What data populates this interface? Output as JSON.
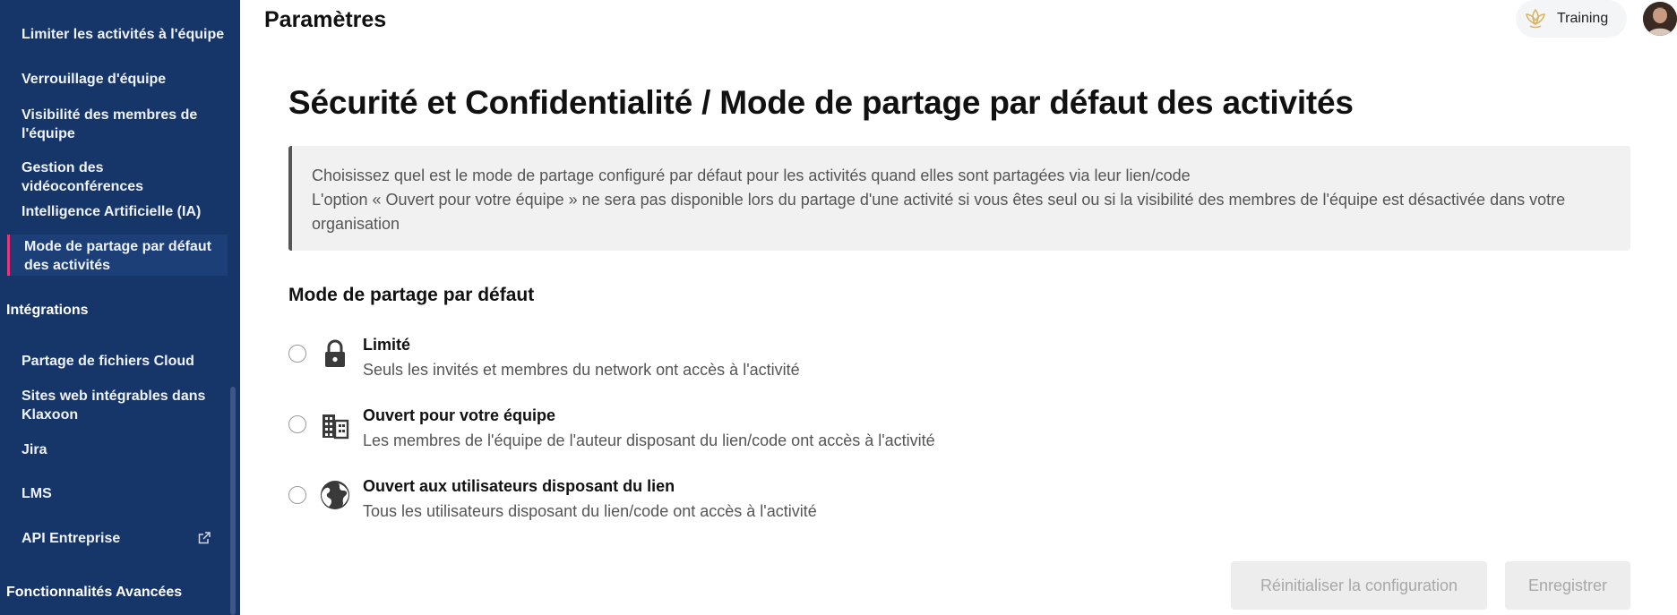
{
  "sidebar": {
    "items": [
      {
        "label": "Limiter les activités à l'équipe"
      },
      {
        "label": "Verrouillage d'équipe"
      },
      {
        "label": "Visibilité des membres de l'équipe"
      },
      {
        "label": "Gestion des vidéoconférences"
      },
      {
        "label": "Intelligence Artificielle (IA)"
      },
      {
        "label": "Mode de partage par défaut des activités",
        "active": true
      }
    ],
    "section_integrations": "Intégrations",
    "integration_items": [
      {
        "label": "Partage de fichiers Cloud"
      },
      {
        "label": "Sites web intégrables dans Klaxoon"
      },
      {
        "label": "Jira"
      },
      {
        "label": "LMS"
      },
      {
        "label": "API Entreprise",
        "icon": "external-link-icon"
      }
    ],
    "section_advanced": "Fonctionnalités Avancées",
    "colors": {
      "background": "#163569",
      "active_marker": "#e8357a"
    }
  },
  "header": {
    "title": "Paramètres",
    "workspace_label": "Training",
    "workspace_icon": "lotus-logo-icon"
  },
  "main": {
    "title": "Sécurité et Confidentialité / Mode de partage par défaut des activités",
    "info_line1": "Choisissez quel est le mode de partage configuré par défaut pour les activités quand elles sont partagées via leur lien/code",
    "info_line2": "L'option « Ouvert pour votre équipe » ne sera pas disponible lors du partage d'une activité si vous êtes seul ou si la visibilité des membres de l'équipe est désactivée dans votre organisation",
    "section_title": "Mode de partage par défaut",
    "options": [
      {
        "title": "Limité",
        "description": "Seuls les invités et membres du network ont accès à l'activité",
        "icon": "lock-icon"
      },
      {
        "title": "Ouvert pour votre équipe",
        "description": "Les membres de l'équipe de l'auteur disposant du lien/code ont accès à l'activité",
        "icon": "building-icon"
      },
      {
        "title": "Ouvert aux utilisateurs disposant du lien",
        "description": "Tous les utilisateurs disposant du lien/code ont accès à l'activité",
        "icon": "globe-icon"
      }
    ],
    "reset_label": "Réinitialiser la configuration",
    "save_label": "Enregistrer"
  }
}
